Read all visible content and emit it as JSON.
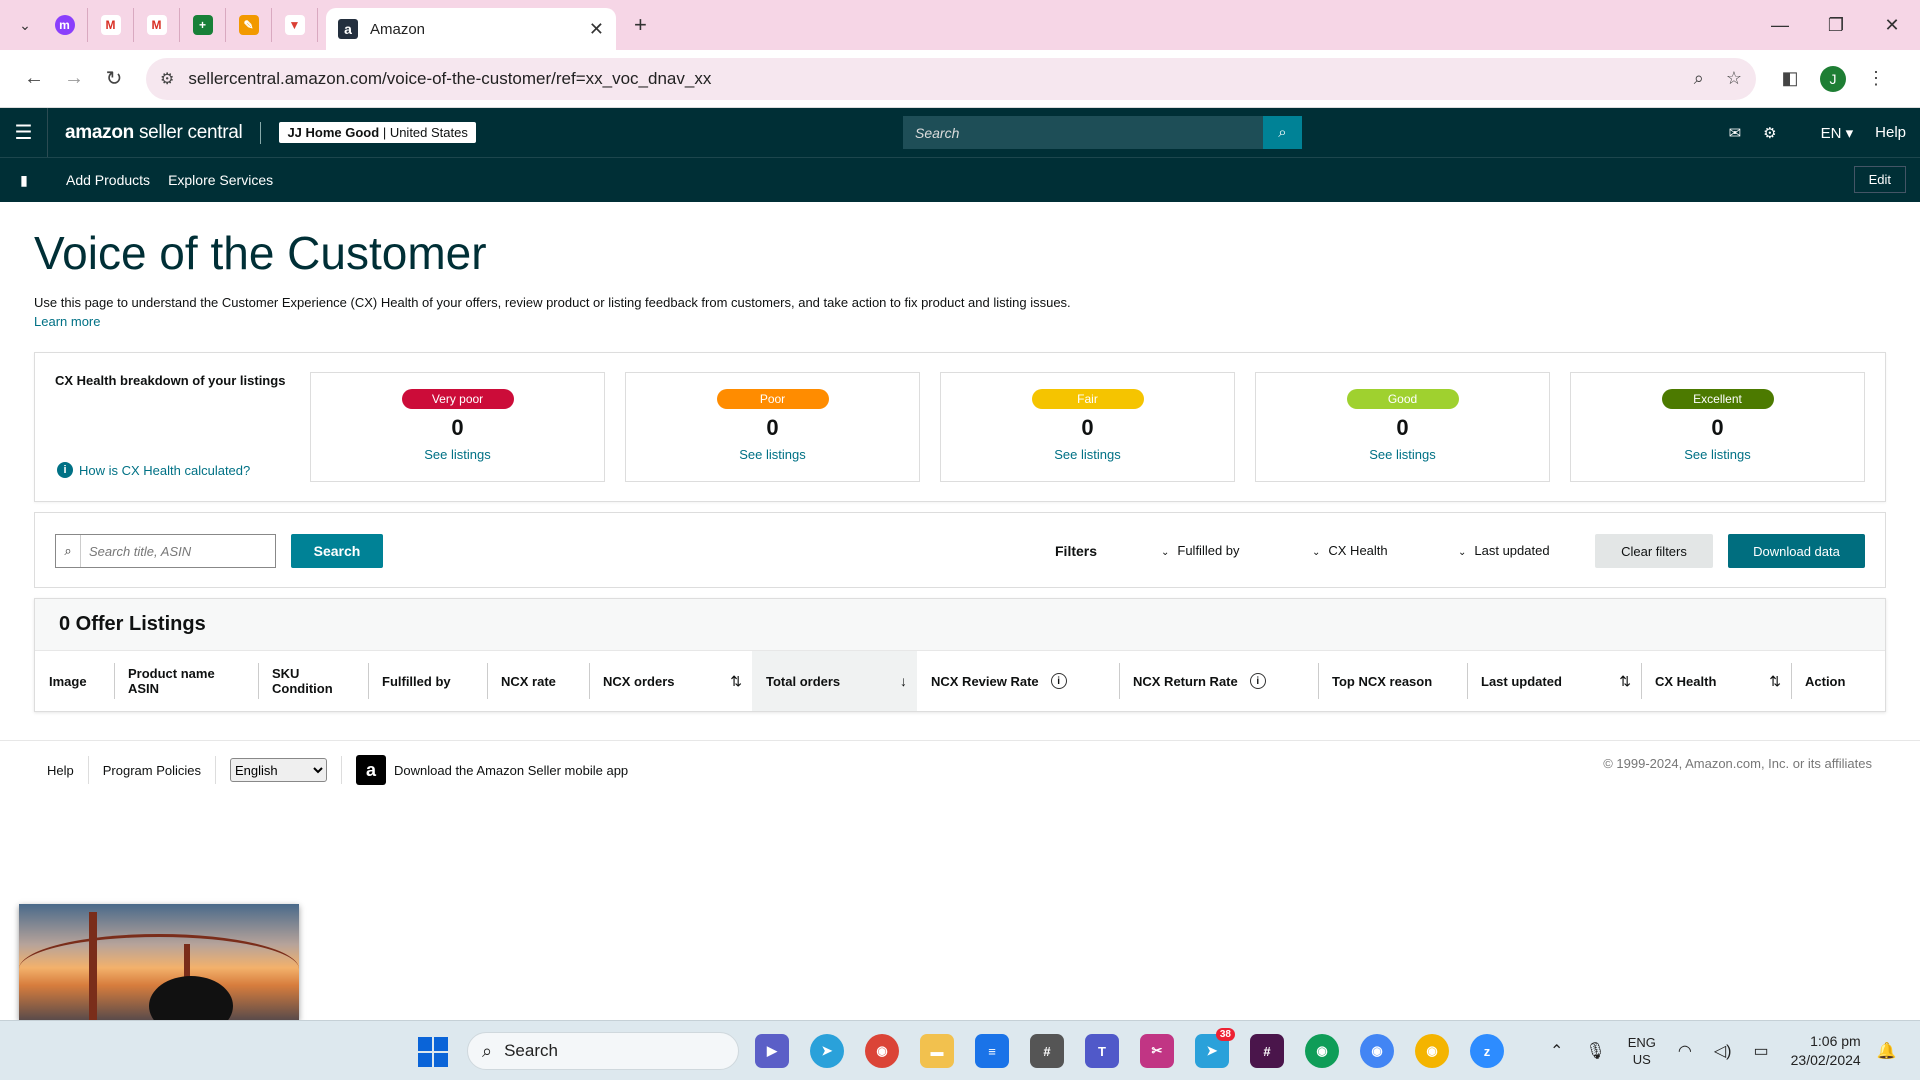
{
  "browser": {
    "active_tab_title": "Amazon",
    "url": "sellercentral.amazon.com/voice-of-the-customer/ref=xx_voc_dnav_xx",
    "profile_initial": "J"
  },
  "header": {
    "logo_main": "amazon",
    "logo_sub": "seller central",
    "store_name": "JJ Home Good",
    "store_region": "United States",
    "search_placeholder": "Search",
    "lang": "EN",
    "help": "Help"
  },
  "nav": {
    "add_products": "Add Products",
    "explore_services": "Explore Services",
    "edit": "Edit"
  },
  "page": {
    "title": "Voice of the Customer",
    "intro": "Use this page to understand the Customer Experience (CX) Health of your offers, review product or listing feedback from customers, and take action to fix product and listing issues.",
    "learn_more": "Learn more"
  },
  "cx_health": {
    "heading": "CX Health breakdown of your listings",
    "how_link": "How is CX Health calculated?",
    "cards": [
      {
        "label": "Very poor",
        "count": "0",
        "link": "See listings",
        "color": "#cc0c39"
      },
      {
        "label": "Poor",
        "count": "0",
        "link": "See listings",
        "color": "#ff8c00"
      },
      {
        "label": "Fair",
        "count": "0",
        "link": "See listings",
        "color": "#f5c400"
      },
      {
        "label": "Good",
        "count": "0",
        "link": "See listings",
        "color": "#9fd12f"
      },
      {
        "label": "Excellent",
        "count": "0",
        "link": "See listings",
        "color": "#4c7a00"
      }
    ]
  },
  "filters": {
    "search_placeholder": "Search title, ASIN",
    "search_button": "Search",
    "filters_label": "Filters",
    "fulfilled_by": "Fulfilled by",
    "cx_health": "CX Health",
    "last_updated": "Last updated",
    "clear": "Clear filters",
    "download": "Download data"
  },
  "listings": {
    "title": "0 Offer Listings",
    "columns": [
      {
        "line1": "Image",
        "line2": ""
      },
      {
        "line1": "Product name",
        "line2": "ASIN"
      },
      {
        "line1": "SKU",
        "line2": "Condition"
      },
      {
        "line1": "Fulfilled by",
        "line2": ""
      },
      {
        "line1": "NCX rate",
        "line2": ""
      },
      {
        "line1": "NCX orders",
        "line2": ""
      },
      {
        "line1": "Total orders",
        "line2": ""
      },
      {
        "line1": "NCX Review Rate",
        "line2": ""
      },
      {
        "line1": "NCX Return Rate",
        "line2": ""
      },
      {
        "line1": "Top NCX reason",
        "line2": ""
      },
      {
        "line1": "Last updated",
        "line2": ""
      },
      {
        "line1": "CX Health",
        "line2": ""
      },
      {
        "line1": "Action",
        "line2": ""
      }
    ]
  },
  "footer": {
    "help": "Help",
    "program_policies": "Program Policies",
    "language": "English",
    "app_link": "Download the Amazon Seller mobile app",
    "copyright": "© 1999-2024, Amazon.com, Inc. or its affiliates"
  },
  "taskbar": {
    "search": "Search",
    "telegram_badge": "38",
    "lang_line1": "ENG",
    "lang_line2": "US",
    "time": "1:06 pm",
    "date": "23/02/2024"
  }
}
